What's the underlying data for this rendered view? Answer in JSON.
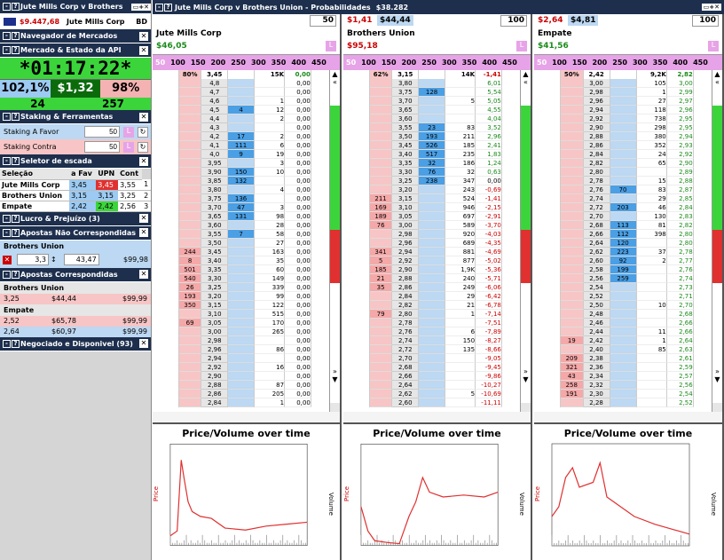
{
  "left": {
    "title": "Jute Mills Corp v Brothers",
    "balance": "$9.447,68",
    "event": "Jute Mills Corp",
    "country": "BD",
    "sections": {
      "nav": "Navegador de Mercados",
      "market": "Mercado & Estado da API",
      "staking": "Staking & Ferramentas",
      "ladder_selector": "Seletor de escada",
      "pl": "Lucro & Prejuízo (3)",
      "unmatched": "Apostas Não Correspondidas",
      "matched": "Apostas Correspondidas",
      "traded": "Negociado e Disponivel (93)"
    },
    "clock": "*01:17:22*",
    "book_back": "102,1%",
    "matched_amount": "$1,32",
    "book_lay": "98%",
    "runners_count": "24",
    "bets_count": "257",
    "stake_back_label": "Staking A Favor",
    "stake_back_value": "50",
    "stake_lay_label": "Staking Contra",
    "stake_lay_value": "50",
    "selector_headers": [
      "Seleção",
      "a Fav",
      "UPN",
      "Cont"
    ],
    "selector_rows": [
      [
        "Jute Mills Corp",
        "3,45",
        "3,45",
        "3,55",
        "1"
      ],
      [
        "Brothers Union",
        "3,15",
        "3,15",
        "3,25",
        "2"
      ],
      [
        "Empate",
        "2,42",
        "2,42",
        "2,56",
        "3"
      ]
    ],
    "unmatched_runner": "Brothers Union",
    "unmatched_odds": "3,3",
    "unmatched_stake": "43,47",
    "unmatched_liab": "$99,98",
    "matched_groups": [
      {
        "runner": "Brothers Union",
        "bets": [
          [
            "3,25",
            "$44,44",
            "$99,99"
          ]
        ]
      },
      {
        "runner": "Empate",
        "bets": [
          [
            "2,52",
            "$65,78",
            "$99,99"
          ],
          [
            "2,64",
            "$60,97",
            "$99,99"
          ]
        ]
      }
    ]
  },
  "market": {
    "title": "Jute Mills Corp v Brothers Union - Probabilidades",
    "amount": "$38.282",
    "zoom_levels": [
      "50",
      "100",
      "150",
      "200",
      "250",
      "300",
      "350",
      "400",
      "450"
    ],
    "runners": [
      {
        "name": "Jute Mills Corp",
        "pl_top": "",
        "pl_green": "$46,05",
        "pl_red": "",
        "stake": "50",
        "ltp_pct": "80%",
        "ltp": "3,45",
        "vol": "15K",
        "pl_last": "0,00",
        "chart_title": "Price/Volume over time",
        "rows": [
          [
            "",
            "4,8",
            "",
            "",
            "0,00"
          ],
          [
            "",
            "4,7",
            "",
            "",
            "0,00"
          ],
          [
            "",
            "4,6",
            "",
            "1",
            "0,00"
          ],
          [
            "",
            "4,5",
            "4",
            "12",
            "0,00"
          ],
          [
            "",
            "4,4",
            "",
            "2",
            "0,00"
          ],
          [
            "",
            "4,3",
            "",
            "",
            "0,00"
          ],
          [
            "",
            "4,2",
            "17",
            "2",
            "0,00"
          ],
          [
            "",
            "4,1",
            "111",
            "6",
            "0,00"
          ],
          [
            "",
            "4,0",
            "9",
            "19",
            "0,00"
          ],
          [
            "",
            "3,95",
            "",
            "3",
            "0,00"
          ],
          [
            "",
            "3,90",
            "150",
            "10",
            "0,00"
          ],
          [
            "",
            "3,85",
            "132",
            "",
            "0,00"
          ],
          [
            "",
            "3,80",
            "",
            "4",
            "0,00"
          ],
          [
            "",
            "3,75",
            "136",
            "",
            "0,00"
          ],
          [
            "",
            "3,70",
            "47",
            "3",
            "0,00"
          ],
          [
            "",
            "3,65",
            "131",
            "98",
            "0,00"
          ],
          [
            "",
            "3,60",
            "",
            "28",
            "0,00"
          ],
          [
            "",
            "3,55",
            "7",
            "58",
            "0,00"
          ],
          [
            "",
            "3,50",
            "",
            "27",
            "0,00"
          ],
          [
            "244",
            "3,45",
            "",
            "163",
            "0,00"
          ],
          [
            "8",
            "3,40",
            "",
            "35",
            "0,00"
          ],
          [
            "501",
            "3,35",
            "",
            "60",
            "0,00"
          ],
          [
            "540",
            "3,30",
            "",
            "149",
            "0,00"
          ],
          [
            "26",
            "3,25",
            "",
            "339",
            "0,00"
          ],
          [
            "193",
            "3,20",
            "",
            "99",
            "0,00"
          ],
          [
            "350",
            "3,15",
            "",
            "122",
            "0,00"
          ],
          [
            "",
            "3,10",
            "",
            "515",
            "0,00"
          ],
          [
            "69",
            "3,05",
            "",
            "170",
            "0,00"
          ],
          [
            "",
            "3,00",
            "",
            "265",
            "0,00"
          ],
          [
            "",
            "2,98",
            "",
            "",
            "0,00"
          ],
          [
            "",
            "2,96",
            "",
            "86",
            "0,00"
          ],
          [
            "",
            "2,94",
            "",
            "",
            "0,00"
          ],
          [
            "",
            "2,92",
            "",
            "16",
            "0,00"
          ],
          [
            "",
            "2,90",
            "",
            "",
            "0,00"
          ],
          [
            "",
            "2,88",
            "",
            "87",
            "0,00"
          ],
          [
            "",
            "2,86",
            "",
            "205",
            "0,00"
          ],
          [
            "",
            "2,84",
            "",
            "1",
            "0,00"
          ]
        ]
      },
      {
        "name": "Brothers Union",
        "pl_top": "$1,41",
        "pl_green": "",
        "pl_red": "$95,18",
        "stake": "100",
        "ltp_pct": "62%",
        "ltp": "3,15",
        "vol": "14K",
        "pl_last": "-1,41",
        "top_box": "$44,44",
        "chart_title": "Price/Volume over time",
        "rows": [
          [
            "",
            "3,80",
            "",
            "",
            "6,01"
          ],
          [
            "",
            "3,75",
            "128",
            "",
            "5,54"
          ],
          [
            "",
            "3,70",
            "",
            "5",
            "5,05"
          ],
          [
            "",
            "3,65",
            "",
            "",
            "4,55"
          ],
          [
            "",
            "3,60",
            "",
            "",
            "4,04"
          ],
          [
            "",
            "3,55",
            "23",
            "83",
            "3,52"
          ],
          [
            "",
            "3,50",
            "193",
            "211",
            "2,96"
          ],
          [
            "",
            "3,45",
            "526",
            "185",
            "2,41"
          ],
          [
            "",
            "3,40",
            "517",
            "235",
            "1,83"
          ],
          [
            "",
            "3,35",
            "32",
            "186",
            "1,24"
          ],
          [
            "",
            "3,30",
            "76",
            "32",
            "0,63"
          ],
          [
            "",
            "3,25",
            "238",
            "347",
            "0,00"
          ],
          [
            "",
            "3,20",
            "",
            "243",
            "-0,69"
          ],
          [
            "211",
            "3,15",
            "",
            "524",
            "-1,41"
          ],
          [
            "169",
            "3,10",
            "",
            "946",
            "-2,15"
          ],
          [
            "189",
            "3,05",
            "",
            "697",
            "-2,91"
          ],
          [
            "76",
            "3,00",
            "",
            "589",
            "-3,70"
          ],
          [
            "",
            "2,98",
            "",
            "920",
            "-4,03"
          ],
          [
            "",
            "2,96",
            "",
            "689",
            "-4,35"
          ],
          [
            "341",
            "2,94",
            "",
            "881",
            "-4,69"
          ],
          [
            "5",
            "2,92",
            "",
            "877",
            "-5,02"
          ],
          [
            "185",
            "2,90",
            "",
            "1,9K",
            "-5,36"
          ],
          [
            "21",
            "2,88",
            "",
            "240",
            "-5,71"
          ],
          [
            "35",
            "2,86",
            "",
            "249",
            "-6,06"
          ],
          [
            "",
            "2,84",
            "",
            "29",
            "-6,42"
          ],
          [
            "",
            "2,82",
            "",
            "21",
            "-6,78"
          ],
          [
            "79",
            "2,80",
            "",
            "1",
            "-7,14"
          ],
          [
            "",
            "2,78",
            "",
            "",
            "-7,51"
          ],
          [
            "",
            "2,76",
            "",
            "6",
            "-7,89"
          ],
          [
            "",
            "2,74",
            "",
            "150",
            "-8,27"
          ],
          [
            "",
            "2,72",
            "",
            "135",
            "-8,66"
          ],
          [
            "",
            "2,70",
            "",
            "",
            "-9,05"
          ],
          [
            "",
            "2,68",
            "",
            "",
            "-9,45"
          ],
          [
            "",
            "2,66",
            "",
            "",
            "-9,86"
          ],
          [
            "",
            "2,64",
            "",
            "",
            "-10,27"
          ],
          [
            "",
            "2,62",
            "",
            "5",
            "-10,69"
          ],
          [
            "",
            "2,60",
            "",
            "",
            "-11,11"
          ]
        ]
      },
      {
        "name": "Empate",
        "pl_top": "$2,64",
        "pl_green": "$41,56",
        "pl_red": "",
        "stake": "100",
        "ltp_pct": "50%",
        "ltp": "2,42",
        "vol": "9,2K",
        "pl_last": "2,82",
        "top_box": "$4,81",
        "chart_title": "Price/Volume over time",
        "rows": [
          [
            "",
            "3,00",
            "",
            "105",
            "3,00"
          ],
          [
            "",
            "2,98",
            "",
            "1",
            "2,99"
          ],
          [
            "",
            "2,96",
            "",
            "27",
            "2,97"
          ],
          [
            "",
            "2,94",
            "",
            "118",
            "2,96"
          ],
          [
            "",
            "2,92",
            "",
            "738",
            "2,95"
          ],
          [
            "",
            "2,90",
            "",
            "298",
            "2,95"
          ],
          [
            "",
            "2,88",
            "",
            "380",
            "2,94"
          ],
          [
            "",
            "2,86",
            "",
            "352",
            "2,93"
          ],
          [
            "",
            "2,84",
            "",
            "24",
            "2,92"
          ],
          [
            "",
            "2,82",
            "",
            "65",
            "2,90"
          ],
          [
            "",
            "2,80",
            "",
            "",
            "2,89"
          ],
          [
            "",
            "2,78",
            "",
            "15",
            "2,88"
          ],
          [
            "",
            "2,76",
            "70",
            "83",
            "2,87"
          ],
          [
            "",
            "2,74",
            "",
            "29",
            "2,85"
          ],
          [
            "",
            "2,72",
            "203",
            "46",
            "2,84"
          ],
          [
            "",
            "2,70",
            "",
            "130",
            "2,83"
          ],
          [
            "",
            "2,68",
            "113",
            "81",
            "2,82"
          ],
          [
            "",
            "2,66",
            "112",
            "398",
            "2,80"
          ],
          [
            "",
            "2,64",
            "120",
            "",
            "2,80"
          ],
          [
            "",
            "2,62",
            "223",
            "37",
            "2,78"
          ],
          [
            "",
            "2,60",
            "92",
            "2",
            "2,77"
          ],
          [
            "",
            "2,58",
            "199",
            "",
            "2,76"
          ],
          [
            "",
            "2,56",
            "259",
            "",
            "2,74"
          ],
          [
            "",
            "2,54",
            "",
            "",
            "2,73"
          ],
          [
            "",
            "2,52",
            "",
            "",
            "2,71"
          ],
          [
            "",
            "2,50",
            "",
            "10",
            "2,70"
          ],
          [
            "",
            "2,48",
            "",
            "",
            "2,68"
          ],
          [
            "",
            "2,46",
            "",
            "",
            "2,66"
          ],
          [
            "",
            "2,44",
            "",
            "11",
            "2,66"
          ],
          [
            "19",
            "2,42",
            "",
            "1",
            "2,64"
          ],
          [
            "",
            "2,40",
            "",
            "85",
            "2,63"
          ],
          [
            "209",
            "2,38",
            "",
            "",
            "2,61"
          ],
          [
            "321",
            "2,36",
            "",
            "",
            "2,59"
          ],
          [
            "43",
            "2,34",
            "",
            "",
            "2,57"
          ],
          [
            "258",
            "2,32",
            "",
            "",
            "2,56"
          ],
          [
            "191",
            "2,30",
            "",
            "",
            "2,54"
          ],
          [
            "",
            "2,28",
            "",
            "",
            "2,52"
          ]
        ]
      }
    ]
  },
  "colors": {
    "title_bg": "#1d2f4d",
    "back": "#5aa0e0",
    "lay": "#f08080",
    "green": "#3bd53b",
    "pink": "#e7a3e7"
  }
}
